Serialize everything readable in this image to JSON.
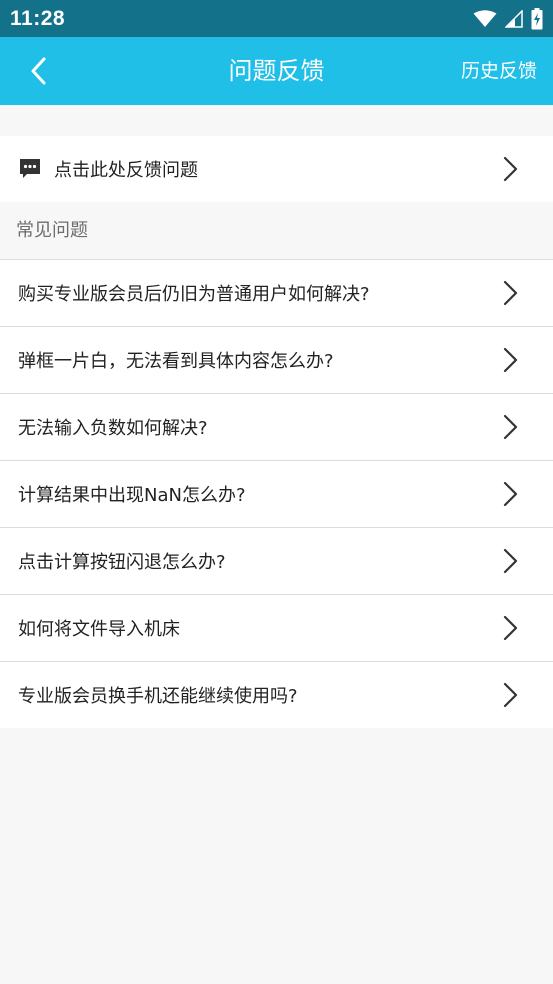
{
  "status_bar": {
    "time": "11:28",
    "icons": [
      "wifi-icon",
      "signal-icon",
      "battery-charging-icon"
    ]
  },
  "app_bar": {
    "back_icon": "chevron-left-icon",
    "title": "问题反馈",
    "history_label": "历史反馈"
  },
  "feedback_entry": {
    "icon": "chat-bubble-icon",
    "label": "点击此处反馈问题"
  },
  "faq": {
    "header": "常见问题",
    "items": [
      "购买专业版会员后仍旧为普通用户如何解决?",
      "弹框一片白，无法看到具体内容怎么办?",
      "无法输入负数如何解决?",
      "计算结果中出现NaN怎么办?",
      "点击计算按钮闪退怎么办?",
      "如何将文件导入机床",
      "专业版会员换手机还能继续使用吗?"
    ]
  },
  "colors": {
    "status_bar": "#13718a",
    "app_bar": "#20bfe8",
    "background": "#f7f7f7"
  }
}
